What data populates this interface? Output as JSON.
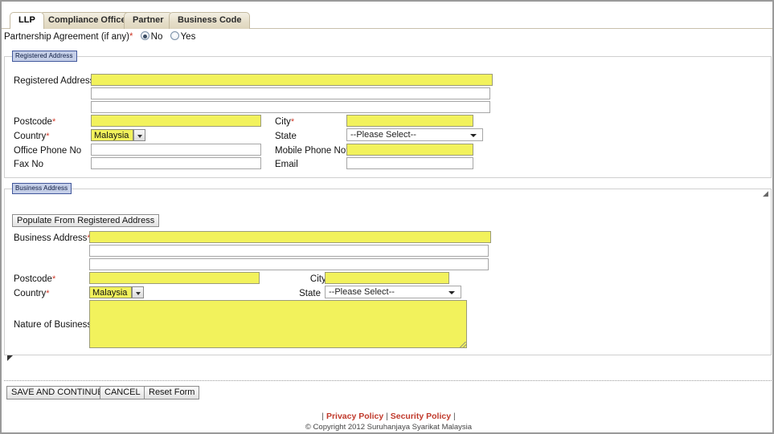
{
  "tabs": [
    {
      "label": "LLP",
      "active": true
    },
    {
      "label": "Compliance Officer",
      "active": false
    },
    {
      "label": "Partner",
      "active": false
    },
    {
      "label": "Business Code",
      "active": false
    }
  ],
  "partnership": {
    "label": "Partnership Agreement (if any)",
    "required_mark": "*",
    "options": [
      {
        "label": "No",
        "selected": true
      },
      {
        "label": "Yes",
        "selected": false
      }
    ]
  },
  "registered_address": {
    "legend": "Registered Address",
    "fields": {
      "address_label": "Registered Address",
      "address_line1": "",
      "address_line2": "",
      "address_line3": "",
      "postcode_label": "Postcode",
      "postcode_value": "",
      "city_label": "City",
      "city_value": "",
      "country_label": "Country",
      "country_value": "Malaysia",
      "state_label": "State",
      "state_value": "--Please Select--",
      "office_phone_label": "Office Phone No",
      "office_phone_value": "",
      "mobile_phone_label": "Mobile Phone No",
      "mobile_phone_value": "",
      "fax_label": "Fax No",
      "fax_value": "",
      "email_label": "Email",
      "email_value": ""
    }
  },
  "business_address": {
    "legend": "Business Address",
    "populate_button": "Populate From Registered Address",
    "fields": {
      "address_label": "Business Address",
      "address_line1": "",
      "address_line2": "",
      "address_line3": "",
      "postcode_label": "Postcode",
      "postcode_value": "",
      "city_label": "City",
      "city_value": "",
      "country_label": "Country",
      "country_value": "Malaysia",
      "state_label": "State",
      "state_value": "--Please Select--",
      "nature_label": "Nature of Business",
      "nature_value": ""
    }
  },
  "actions": {
    "save": "SAVE AND CONTINUE",
    "cancel": "CANCEL",
    "reset": "Reset Form"
  },
  "footer": {
    "pipe_left": "|",
    "privacy": "Privacy Policy",
    "pipe_mid": "|",
    "security": "Security Policy",
    "pipe_right": "|",
    "copyright": "© Copyright 2012 Suruhanjaya Syarikat Malaysia"
  },
  "colors": {
    "required_field": "#f2f25c",
    "required_mark": "#d03a2a",
    "legend_bg": "#c5cfe8",
    "legend_border": "#42589c",
    "link": "#c0392b"
  }
}
